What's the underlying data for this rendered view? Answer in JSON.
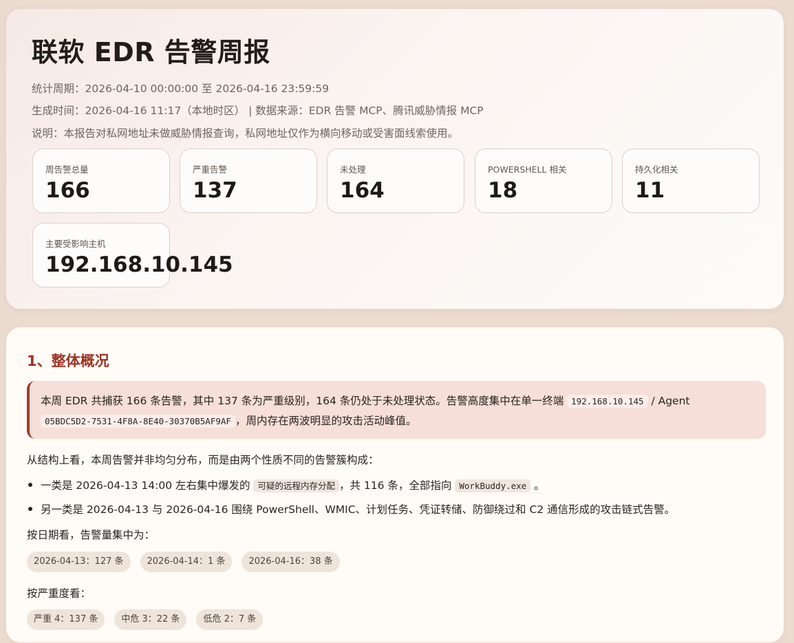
{
  "header": {
    "title": "联软 EDR 告警周报",
    "period": "统计周期：2026-04-10 00:00:00 至 2026-04-16 23:59:59",
    "generated": "生成时间：2026-04-16 11:17（本地时区） | 数据来源：EDR 告警 MCP、腾讯威胁情报 MCP",
    "note": "说明：本报告对私网地址未做威胁情报查询，私网地址仅作为横向移动或受害面线索使用。"
  },
  "stats": [
    {
      "label": "周告警总量",
      "value": "166"
    },
    {
      "label": "严重告警",
      "value": "137"
    },
    {
      "label": "未处理",
      "value": "164"
    },
    {
      "label": "POWERSHELL 相关",
      "value": "18"
    },
    {
      "label": "持久化相关",
      "value": "11"
    },
    {
      "label": "主要受影响主机",
      "value": "192.168.10.145"
    }
  ],
  "section1": {
    "title": "1、整体概况",
    "callout": {
      "text1": "本周 EDR 共捕获 166 条告警，其中 137 条为严重级别，164 条仍处于未处理状态。告警高度集中在单一终端 ",
      "code1": "192.168.10.145",
      "text2": " / Agent ",
      "code2": "05BDC5D2-7531-4F8A-8E40-30370B5AF9AF",
      "text3": "，周内存在两波明显的攻击活动峰值。"
    },
    "structure_intro": "从结构上看，本周告警并非均匀分布，而是由两个性质不同的告警簇构成：",
    "bullet1": {
      "text1": "一类是 2026-04-13 14:00 左右集中爆发的 ",
      "code1": "可疑的远程内存分配",
      "text2": "，共 116 条，全部指向 ",
      "code2": "WorkBuddy.exe",
      "text3": " 。"
    },
    "bullet2": "另一类是 2026-04-13 与 2026-04-16 围绕 PowerShell、WMIC、计划任务、凭证转储、防御绕过和 C2 通信形成的攻击链式告警。",
    "by_date_label": "按日期看，告警量集中为：",
    "by_date": [
      "2026-04-13：127 条",
      "2026-04-14：1 条",
      "2026-04-16：38 条"
    ],
    "by_severity_label": "按严重度看：",
    "by_severity": [
      "严重 4：137 条",
      "中危 3：22 条",
      "低危 2：7 条"
    ]
  }
}
